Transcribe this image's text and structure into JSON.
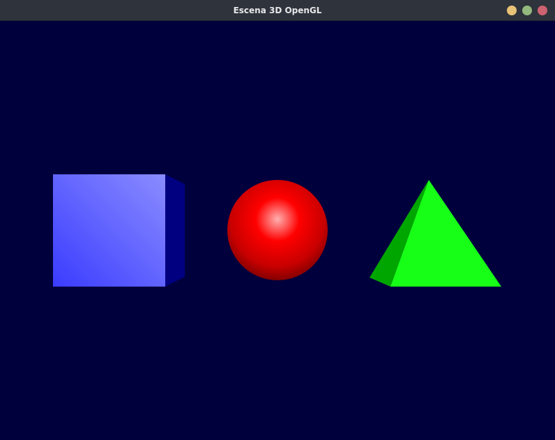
{
  "window": {
    "title": "Escena 3D OpenGL",
    "controls": {
      "minimize_color": "#e8c377",
      "maximize_color": "#93b97e",
      "close_color": "#cd6270"
    }
  },
  "scene": {
    "background_color": "#00003d",
    "objects": [
      {
        "type": "cube",
        "front_color_light": "#8a8cff",
        "front_color_dark": "#3a3cff",
        "side_color": "#000080"
      },
      {
        "type": "sphere",
        "highlight_color": "#ffb0b0",
        "base_color": "#ff0000",
        "shadow_color": "#7a0000"
      },
      {
        "type": "pyramid",
        "front_color": "#17ff17",
        "side_color": "#00a600"
      }
    ]
  }
}
